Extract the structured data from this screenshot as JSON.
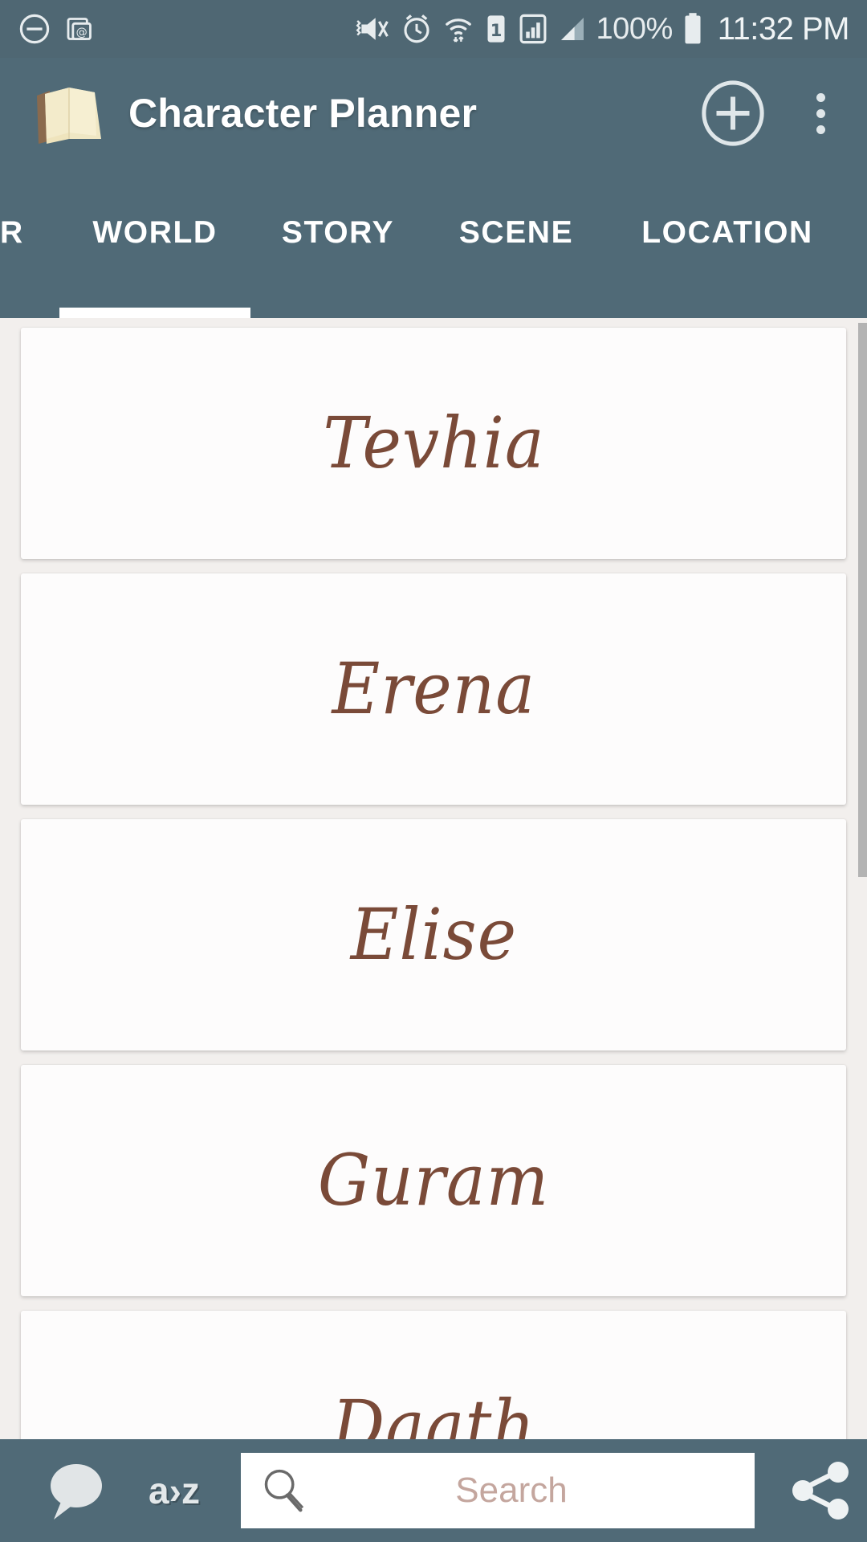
{
  "status_bar": {
    "icons": [
      "do-not-disturb-icon",
      "screenshot-icon",
      "vibrate-off-icon",
      "alarm-icon",
      "wifi-icon",
      "sim-1-icon",
      "signal-bars-icon",
      "signal-triangle-icon"
    ],
    "battery_percent": "100%",
    "battery_icon": "battery-full-icon",
    "time": "11:32 PM"
  },
  "app_bar": {
    "logo_icon": "open-book-icon",
    "title": "Character Planner",
    "add_icon": "plus-circle-icon",
    "overflow_icon": "more-vertical-icon"
  },
  "tabs": {
    "selected_index": 1,
    "items": [
      {
        "label": "R"
      },
      {
        "label": "WORLD"
      },
      {
        "label": "STORY"
      },
      {
        "label": "SCENE"
      },
      {
        "label": "LOCATION"
      }
    ]
  },
  "list": {
    "name_color": "#7a4a38",
    "items": [
      {
        "name": "Tevhia"
      },
      {
        "name": "Erena"
      },
      {
        "name": "Elise"
      },
      {
        "name": "Guram"
      },
      {
        "name": "Daath"
      }
    ]
  },
  "bottom_bar": {
    "chat_icon": "speech-bubble-icon",
    "sort_label": "a›z",
    "sort_icon": "sort-a-to-z-icon",
    "search_icon": "magnifier-icon",
    "search_value": "",
    "search_placeholder": "Search",
    "share_icon": "share-icon"
  },
  "theme": {
    "bar_color": "#506a77",
    "status_bar_color": "#4f6773",
    "content_bg": "#f2efed",
    "card_bg": "#fdfcfc",
    "accent": "#ffffff"
  }
}
